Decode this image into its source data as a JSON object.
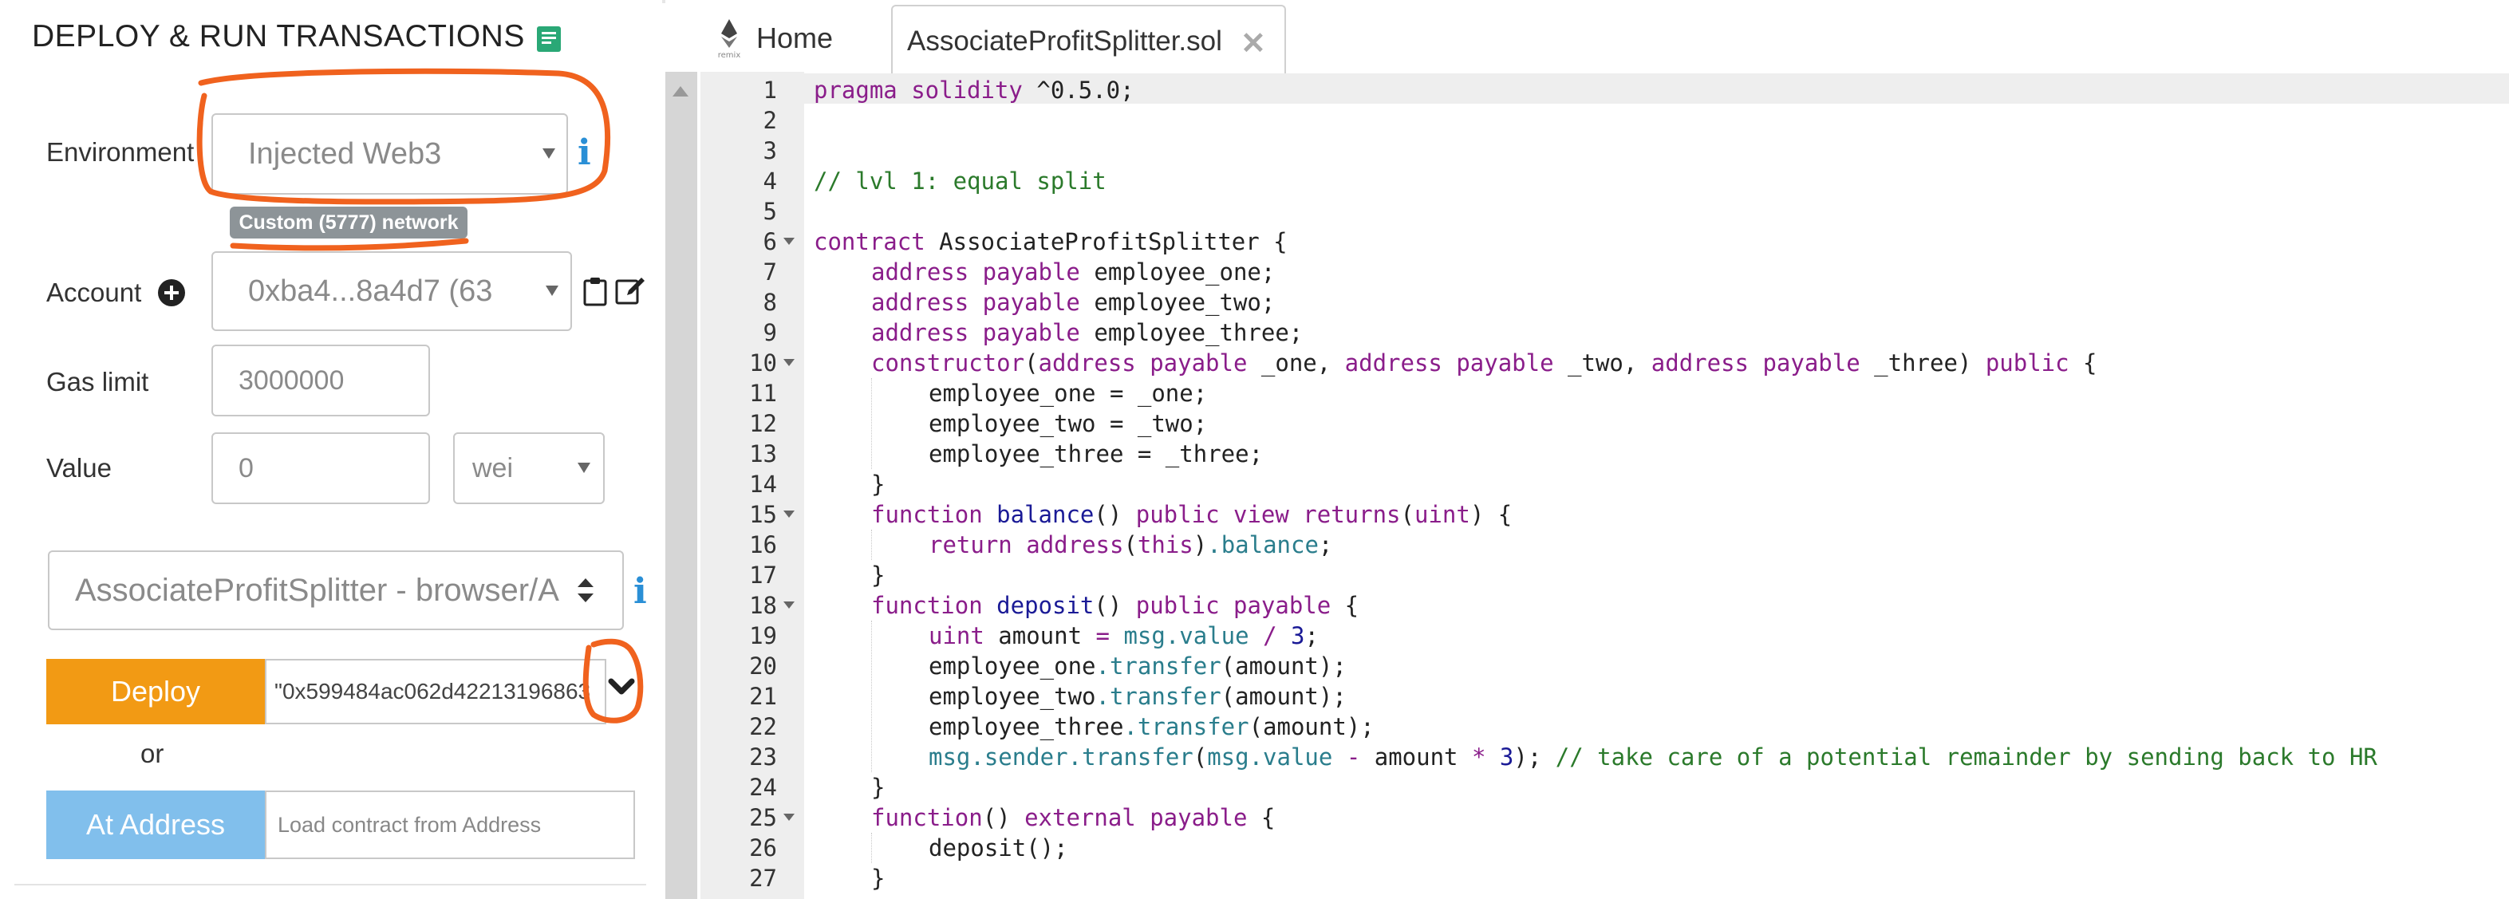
{
  "panel": {
    "title": "DEPLOY & RUN TRANSACTIONS",
    "environment": {
      "label": "Environment",
      "value": "Injected Web3",
      "network_badge": "Custom (5777) network"
    },
    "account": {
      "label": "Account",
      "value": "0xba4...8a4d7 (63"
    },
    "gas_limit": {
      "label": "Gas limit",
      "value": "3000000"
    },
    "value": {
      "label": "Value",
      "amount": "0",
      "unit": "wei"
    },
    "contract_select": "AssociateProfitSplitter - browser/A",
    "deploy": {
      "label": "Deploy",
      "params": "\"0x599484ac062d42213196863"
    },
    "or_text": "or",
    "at_address": {
      "label": "At Address",
      "placeholder": "Load contract from Address"
    }
  },
  "editor": {
    "tabs": [
      {
        "label": "Home"
      },
      {
        "label": "AssociateProfitSplitter.sol"
      }
    ],
    "logo_text": "remix",
    "line_numbers": [
      "1",
      "2",
      "3",
      "4",
      "5",
      "6",
      "7",
      "8",
      "9",
      "10",
      "11",
      "12",
      "13",
      "14",
      "15",
      "16",
      "17",
      "18",
      "19",
      "20",
      "21",
      "22",
      "23",
      "24",
      "25",
      "26",
      "27"
    ],
    "code": {
      "l1_a": "pragma solidity",
      "l1_b": " ^0.5.0;",
      "l4": "// lvl 1: equal split",
      "l6_a": "contract",
      "l6_b": " AssociateProfitSplitter {",
      "l7_a": "address payable",
      "l7_b": " employee_one;",
      "l8_a": "address payable",
      "l8_b": " employee_two;",
      "l9_a": "address payable",
      "l9_b": " employee_three;",
      "l10_a": "constructor",
      "l10_b": "(",
      "l10_c": "address payable",
      "l10_d": " _one, ",
      "l10_e": "address payable",
      "l10_f": " _two, ",
      "l10_g": "address payable",
      "l10_h": " _three) ",
      "l10_i": "public",
      "l10_j": " {",
      "l11": "employee_one = _one;",
      "l12": "employee_two = _two;",
      "l13": "employee_three = _three;",
      "l14": "}",
      "l15_a": "function",
      "l15_b": " balance",
      "l15_c": "() ",
      "l15_d": "public view returns",
      "l15_e": "(",
      "l15_f": "uint",
      "l15_g": ") {",
      "l16_a": "return",
      "l16_b": " ",
      "l16_c": "address",
      "l16_d": "(",
      "l16_e": "this",
      "l16_f": ")",
      "l16_g": ".balance",
      "l16_h": ";",
      "l17": "}",
      "l18_a": "function",
      "l18_b": " deposit",
      "l18_c": "() ",
      "l18_d": "public payable",
      "l18_e": " {",
      "l19_a": "uint",
      "l19_b": " amount ",
      "l19_c": "=",
      "l19_d": " ",
      "l19_e": "msg.value",
      "l19_f": " / ",
      "l19_g": "3",
      "l19_h": ";",
      "l20_a": "employee_one",
      "l20_b": ".transfer",
      "l20_c": "(amount);",
      "l21_a": "employee_two",
      "l21_b": ".transfer",
      "l21_c": "(amount);",
      "l22_a": "employee_three",
      "l22_b": ".transfer",
      "l22_c": "(amount);",
      "l23_a": "msg.sender",
      "l23_b": ".transfer",
      "l23_c": "(",
      "l23_d": "msg.value",
      "l23_e": " - ",
      "l23_f": "amount",
      "l23_g": " * ",
      "l23_h": "3",
      "l23_i": "); ",
      "l23_j": "// take care of a potential remainder by sending back to HR",
      "l24": "}",
      "l25_a": "function",
      "l25_b": "() ",
      "l25_c": "external payable",
      "l25_d": " {",
      "l26": "deposit();",
      "l27": "}"
    }
  },
  "colors": {
    "deploy_button": "#f29a14",
    "at_address_button": "#81bfec",
    "annotation": "#f0621e",
    "keyword": "#8a1d8a",
    "comment": "#2b7a2b"
  },
  "icons": [
    "book-icon",
    "info-icon",
    "plus-circle-icon",
    "clipboard-icon",
    "edit-icon",
    "chevron-down-icon",
    "close-icon",
    "remix-logo-icon",
    "scroll-up-icon"
  ]
}
